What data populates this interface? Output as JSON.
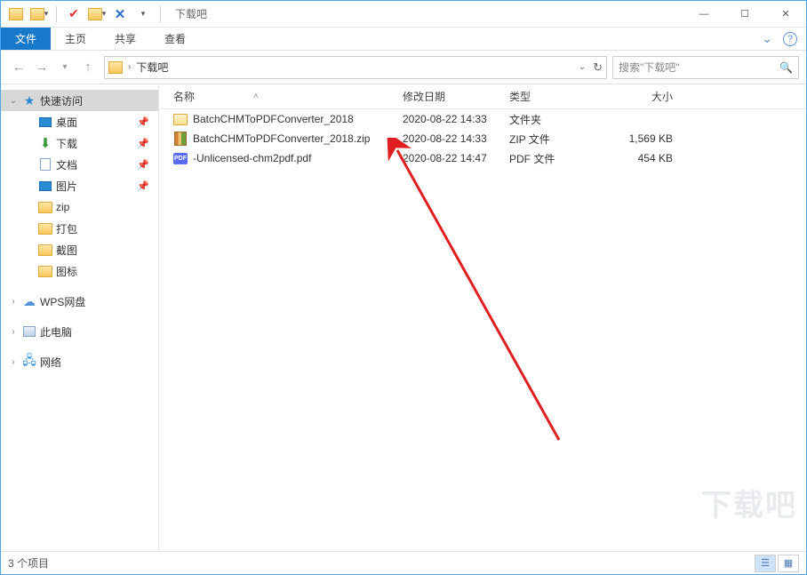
{
  "window": {
    "title": "下载吧"
  },
  "ribbon": {
    "tabs": {
      "file": "文件",
      "home": "主页",
      "share": "共享",
      "view": "查看"
    }
  },
  "nav": {
    "breadcrumb": [
      "下载吧"
    ],
    "refresh_tooltip": "刷新"
  },
  "search": {
    "placeholder": "搜索\"下载吧\""
  },
  "sidebar": {
    "quick_access": "快速访问",
    "items": [
      {
        "label": "桌面",
        "icon": "desktop",
        "pinned": true
      },
      {
        "label": "下载",
        "icon": "down",
        "pinned": true
      },
      {
        "label": "文档",
        "icon": "doc",
        "pinned": true
      },
      {
        "label": "图片",
        "icon": "desktop",
        "pinned": true
      },
      {
        "label": "zip",
        "icon": "folder",
        "pinned": false
      },
      {
        "label": "打包",
        "icon": "folder",
        "pinned": false
      },
      {
        "label": "截图",
        "icon": "folder",
        "pinned": false
      },
      {
        "label": "图标",
        "icon": "folder",
        "pinned": false
      }
    ],
    "wps": "WPS网盘",
    "this_pc": "此电脑",
    "network": "网络"
  },
  "columns": {
    "name": "名称",
    "date": "修改日期",
    "type": "类型",
    "size": "大小"
  },
  "files": [
    {
      "name": "BatchCHMToPDFConverter_2018",
      "date": "2020-08-22 14:33",
      "type": "文件夹",
      "size": "",
      "icon": "folder"
    },
    {
      "name": "BatchCHMToPDFConverter_2018.zip",
      "date": "2020-08-22 14:33",
      "type": "ZIP 文件",
      "size": "1,569 KB",
      "icon": "zip"
    },
    {
      "name": "-Unlicensed-chm2pdf.pdf",
      "date": "2020-08-22 14:47",
      "type": "PDF 文件",
      "size": "454 KB",
      "icon": "pdf"
    }
  ],
  "status": {
    "count": "3 个项目"
  },
  "pdf_badge": "PDF"
}
